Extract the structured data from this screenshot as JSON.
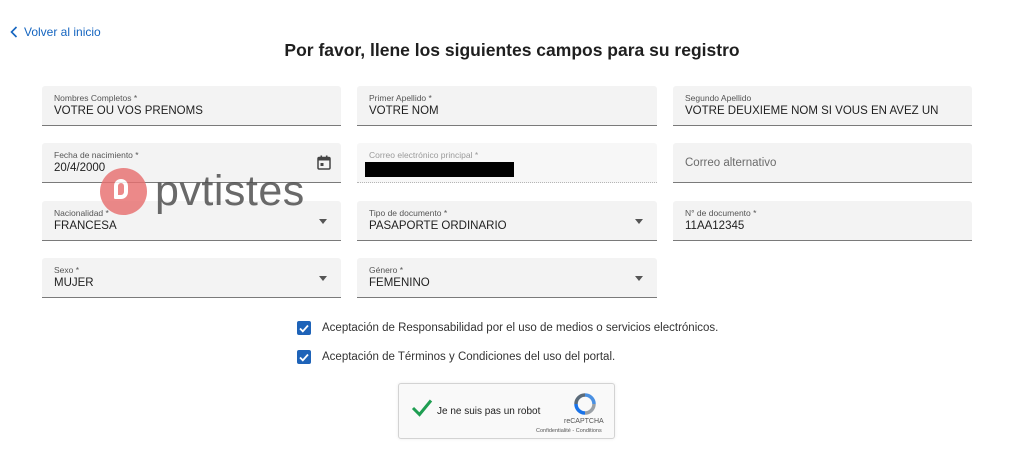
{
  "nav": {
    "back_label": "Volver al inicio"
  },
  "page": {
    "title": "Por favor, llene los siguientes campos para su registro"
  },
  "fields": {
    "nombres": {
      "label": "Nombres Completos *",
      "value": "VOTRE OU VOS PRENOMS"
    },
    "primer_apellido": {
      "label": "Primer Apellido *",
      "value": "VOTRE NOM"
    },
    "segundo_apellido": {
      "label": "Segundo Apellido",
      "value": "VOTRE DEUXIEME NOM SI VOUS EN AVEZ UN"
    },
    "fecha_nacimiento": {
      "label": "Fecha de nacimiento *",
      "value": "20/4/2000"
    },
    "correo_principal": {
      "label": "Correo electrónico principal *",
      "value": ""
    },
    "correo_alternativo": {
      "placeholder": "Correo alternativo"
    },
    "nacionalidad": {
      "label": "Nacionalidad *",
      "value": "FRANCESA"
    },
    "tipo_documento": {
      "label": "Tipo de documento *",
      "value": "PASAPORTE ORDINARIO"
    },
    "numero_documento": {
      "label": "N° de documento *",
      "value": "11AA12345"
    },
    "sexo": {
      "label": "Sexo *",
      "value": "MUJER"
    },
    "genero": {
      "label": "Género *",
      "value": "FEMENINO"
    }
  },
  "checkboxes": [
    {
      "label": "Aceptación de Responsabilidad por el uso de medios o servicios electrónicos.",
      "checked": true
    },
    {
      "label": "Aceptación de Términos y Condiciones del uso del portal.",
      "checked": true
    }
  ],
  "captcha": {
    "text": "Je ne suis pas un robot",
    "brand": "reCAPTCHA",
    "links": "Confidentialité - Conditions",
    "verified": true
  },
  "watermark": {
    "text": "pvtistes"
  },
  "colors": {
    "accent": "#1e63b8",
    "link": "#1565c0",
    "field_bg": "#f3f3f3",
    "captcha_check": "#1f9e52"
  }
}
